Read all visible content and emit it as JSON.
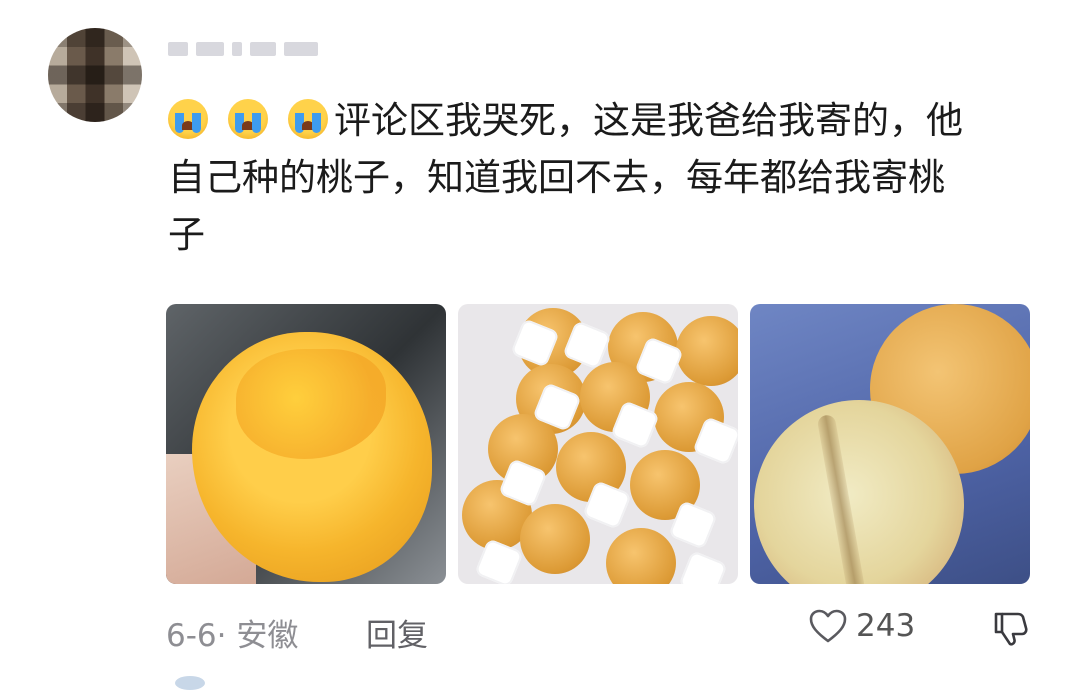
{
  "comment": {
    "emojis": [
      "loudly-crying-face",
      "loudly-crying-face",
      "loudly-crying-face"
    ],
    "line1": "评论区我哭死，这是我爸给我寄的，他",
    "line2": "自己种的桃子，知道我回不去，每年都给我寄桃",
    "line3": "子"
  },
  "photos": [
    "bitten-yellow-peach-in-hand",
    "peaches-in-foam-tray",
    "two-peaches-on-blue"
  ],
  "meta": {
    "date_location": "6-6· 安徽",
    "reply_label": "回复",
    "like_count": "243"
  },
  "icons": {
    "like": "heart-outline-icon",
    "dislike": "thumbs-down-icon"
  }
}
